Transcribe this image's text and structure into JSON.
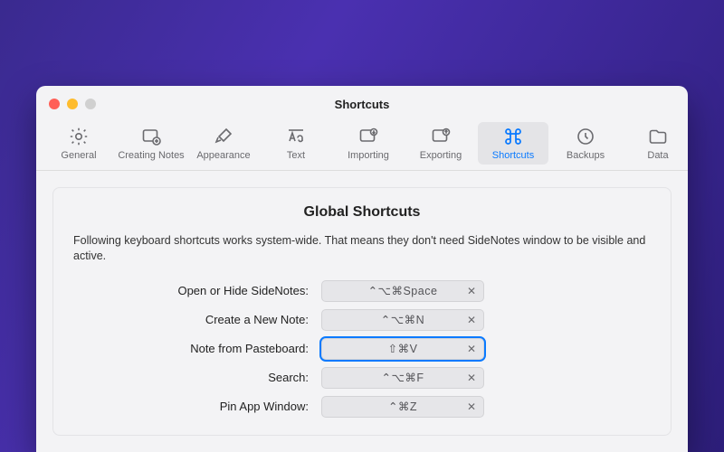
{
  "window": {
    "title": "Shortcuts"
  },
  "toolbar": {
    "items": [
      {
        "id": "general",
        "label": "General"
      },
      {
        "id": "creating-notes",
        "label": "Creating Notes"
      },
      {
        "id": "appearance",
        "label": "Appearance"
      },
      {
        "id": "text",
        "label": "Text"
      },
      {
        "id": "importing",
        "label": "Importing"
      },
      {
        "id": "exporting",
        "label": "Exporting"
      },
      {
        "id": "shortcuts",
        "label": "Shortcuts"
      },
      {
        "id": "backups",
        "label": "Backups"
      },
      {
        "id": "data",
        "label": "Data"
      }
    ],
    "active_id": "shortcuts"
  },
  "panel": {
    "heading": "Global Shortcuts",
    "description": "Following keyboard shortcuts works system-wide. That means they don't need SideNotes window to be visible and active."
  },
  "shortcuts": [
    {
      "label": "Open or Hide SideNotes:",
      "value": "⌃⌥⌘Space",
      "selected": false
    },
    {
      "label": "Create a New Note:",
      "value": "⌃⌥⌘N",
      "selected": false
    },
    {
      "label": "Note from Pasteboard:",
      "value": "⇧⌘V",
      "selected": true
    },
    {
      "label": "Search:",
      "value": "⌃⌥⌘F",
      "selected": false
    },
    {
      "label": "Pin App Window:",
      "value": "⌃⌘Z",
      "selected": false
    }
  ],
  "clear_glyph": "✕"
}
